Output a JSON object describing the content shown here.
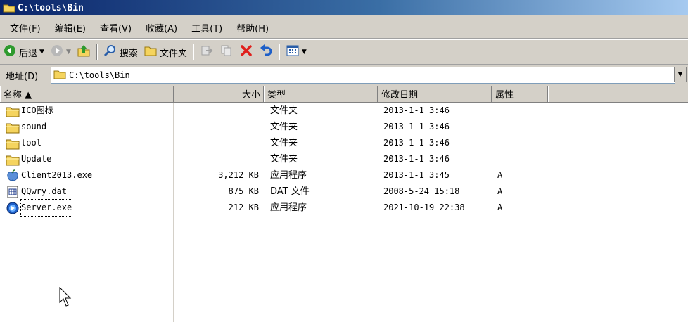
{
  "window": {
    "title": "C:\\tools\\Bin"
  },
  "menu": [
    "文件(F)",
    "编辑(E)",
    "查看(V)",
    "收藏(A)",
    "工具(T)",
    "帮助(H)"
  ],
  "toolbar": {
    "back": "后退",
    "search": "搜索",
    "folders": "文件夹"
  },
  "address": {
    "label": "地址(D)",
    "value": "C:\\tools\\Bin"
  },
  "columns": {
    "name": "名称 ▲",
    "size": "大小",
    "type": "类型",
    "modified": "修改日期",
    "attributes": "属性"
  },
  "files": [
    {
      "name": "ICO图标",
      "size": "",
      "type": "文件夹",
      "modified": "2013-1-1 3:46",
      "attr": "",
      "icon": "folder-icon"
    },
    {
      "name": "sound",
      "size": "",
      "type": "文件夹",
      "modified": "2013-1-1 3:46",
      "attr": "",
      "icon": "folder-icon"
    },
    {
      "name": "tool",
      "size": "",
      "type": "文件夹",
      "modified": "2013-1-1 3:46",
      "attr": "",
      "icon": "folder-icon"
    },
    {
      "name": "Update",
      "size": "",
      "type": "文件夹",
      "modified": "2013-1-1 3:46",
      "attr": "",
      "icon": "folder-icon"
    },
    {
      "name": "Client2013.exe",
      "size": "3,212 KB",
      "type": "应用程序",
      "modified": "2013-1-1 3:45",
      "attr": "A",
      "icon": "apple-app-icon"
    },
    {
      "name": "QQwry.dat",
      "size": "875 KB",
      "type": "DAT 文件",
      "modified": "2008-5-24 15:18",
      "attr": "A",
      "icon": "data-file-icon"
    },
    {
      "name": "Server.exe",
      "size": "212 KB",
      "type": "应用程序",
      "modified": "2021-10-19 22:38",
      "attr": "A",
      "icon": "media-app-icon"
    }
  ],
  "colors": {
    "titlebar": "#0a246a",
    "face": "#d4d0c8",
    "folder": "#f5d45e"
  }
}
